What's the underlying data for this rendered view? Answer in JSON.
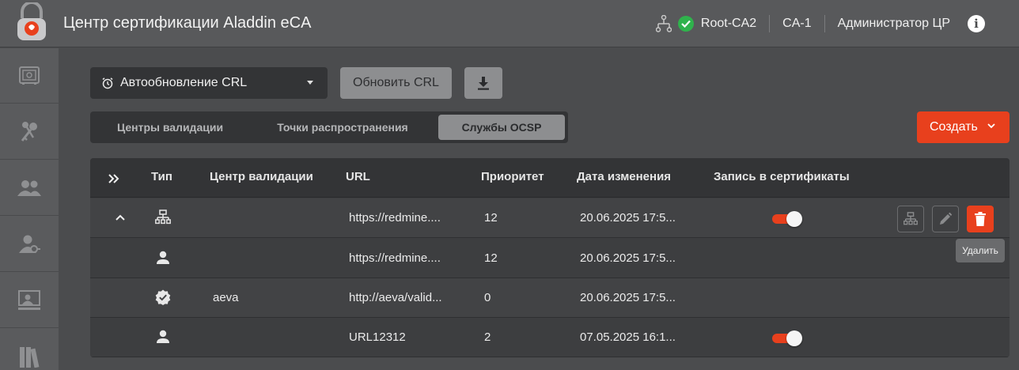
{
  "header": {
    "title": "Центр сертификации Aladdin eCA",
    "ca_root": "Root-CA2",
    "ca_name": "CA-1",
    "user": "Администратор ЦР",
    "status_color": "#2fb24c"
  },
  "sidebar": {
    "items": [
      {
        "icon": "safe-icon"
      },
      {
        "icon": "keys-icon"
      },
      {
        "icon": "users-icon"
      },
      {
        "icon": "user-key-icon"
      },
      {
        "icon": "certificate-user-icon"
      },
      {
        "icon": "library-icon"
      }
    ]
  },
  "toolbar": {
    "crl_select_value": "Автообновление CRL",
    "refresh_label": "Обновить CRL",
    "create_label": "Создать"
  },
  "tabs": [
    {
      "label": "Центры валидации",
      "active": false
    },
    {
      "label": "Точки распространения",
      "active": false
    },
    {
      "label": "Службы OCSP",
      "active": true
    }
  ],
  "table": {
    "columns": [
      "Тип",
      "Центр валидации",
      "URL",
      "Приоритет",
      "Дата изменения",
      "Запись в сертификаты"
    ],
    "rows": [
      {
        "icon": "sitemap-icon",
        "center": "",
        "url": "https://redmine....",
        "priority": "12",
        "date": "20.06.2025 17:5...",
        "write_to_cert": true,
        "expanded": true
      },
      {
        "icon": "person-icon",
        "center": "",
        "url": "https://redmine....",
        "priority": "12",
        "date": "20.06.2025 17:5...",
        "write_to_cert": null
      },
      {
        "icon": "verified-badge-icon",
        "center": "aeva",
        "url": "http://aeva/valid...",
        "priority": "0",
        "date": "20.06.2025 17:5...",
        "write_to_cert": null
      },
      {
        "icon": "person-icon",
        "center": "",
        "url": "URL12312",
        "priority": "2",
        "date": "07.05.2025 16:1...",
        "write_to_cert": true
      }
    ]
  },
  "tooltip": "Удалить",
  "accent_color": "#e8401d"
}
